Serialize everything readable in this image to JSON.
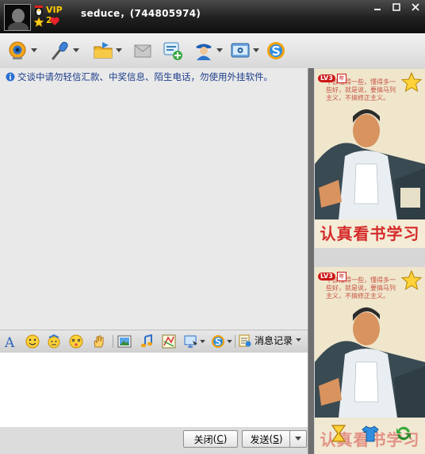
{
  "window": {
    "nickname_line": "seduce，(744805974)",
    "vip_level": "VIP 2",
    "controls": {
      "minimize": "minimize",
      "maximize": "maximize",
      "close": "close"
    }
  },
  "toolbar": {
    "items": [
      {
        "icon": "video-camera-icon"
      },
      {
        "icon": "microphone-icon"
      },
      {
        "icon": "send-file-icon"
      },
      {
        "icon": "sms-message-icon"
      },
      {
        "icon": "create-group-icon"
      },
      {
        "icon": "user-profile-icon"
      },
      {
        "icon": "app-settings-icon"
      },
      {
        "icon": "sogou-icon"
      }
    ]
  },
  "chat": {
    "notice": "交谈中请勿轻信汇款、中奖信息、陌生电话，勿使用外挂软件。"
  },
  "format_toolbar": {
    "message_history_label": "消息记录"
  },
  "buttons": {
    "close_label": "关闭",
    "close_hotkey": "C",
    "send_label": "发送",
    "send_hotkey": "S"
  },
  "show_panel": {
    "level_badge": "LV3",
    "year_badge": "年",
    "poster_slogan": "认真看书学习",
    "poster_text": "干部懂得一些，懂得多一些好，就是说，要搞马列主义，不搞修正主义。"
  },
  "colors": {
    "titlebar": "#1f1f1f",
    "notice_text": "#1c3d8a",
    "slogan_red": "#d42a2a",
    "vip_gold": "#ffcc00"
  }
}
